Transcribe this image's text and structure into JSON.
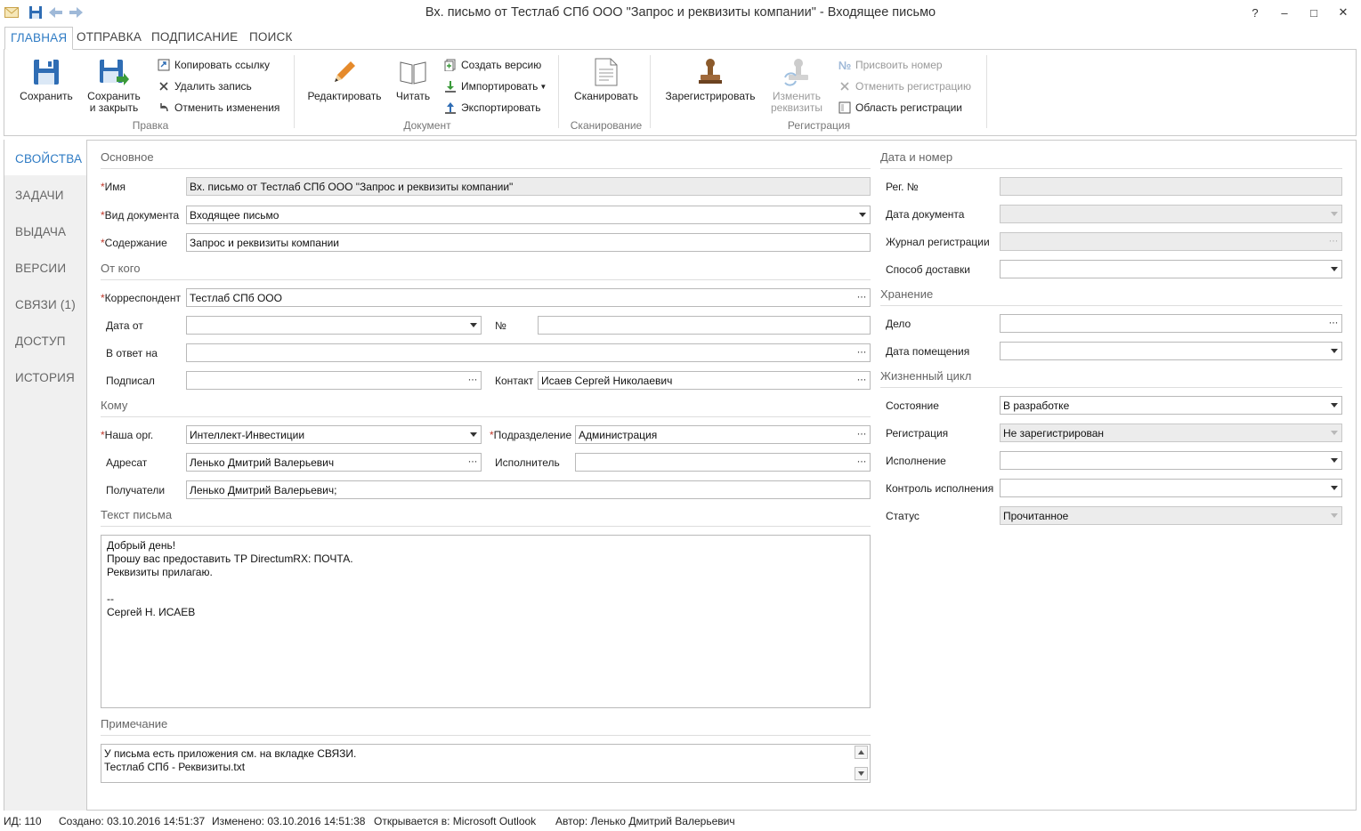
{
  "window": {
    "title": "Вх. письмо от Тестлаб СПб ООО \"Запрос и реквизиты компании\" - Входящее письмо",
    "help": "?",
    "minimize": "–",
    "maximize": "□",
    "close": "✕"
  },
  "ribbon_tabs": [
    "ГЛАВНАЯ",
    "ОТПРАВКА",
    "ПОДПИСАНИЕ",
    "ПОИСК"
  ],
  "ribbon": {
    "save": "Сохранить",
    "save_close_1": "Сохранить",
    "save_close_2": "и закрыть",
    "copy_link": "Копировать ссылку",
    "delete_record": "Удалить запись",
    "undo_changes": "Отменить изменения",
    "group_edit": "Правка",
    "edit": "Редактировать",
    "read": "Читать",
    "create_version": "Создать версию",
    "import": "Импортировать",
    "export": "Экспортировать",
    "group_document": "Документ",
    "scan": "Сканировать",
    "group_scan": "Сканирование",
    "register": "Зарегистрировать",
    "change_requisites_1": "Изменить",
    "change_requisites_2": "реквизиты",
    "assign_number": "Присвоить номер",
    "cancel_registration": "Отменить регистрацию",
    "registration_area": "Область регистрации",
    "group_registration": "Регистрация"
  },
  "leftnav": [
    "СВОЙСТВА",
    "ЗАДАЧИ",
    "ВЫДАЧА",
    "ВЕРСИИ",
    "СВЯЗИ (1)",
    "ДОСТУП",
    "ИСТОРИЯ"
  ],
  "left": {
    "sec_main": "Основное",
    "name_label": "Имя",
    "name_value": "Вх. письмо от Тестлаб СПб ООО \"Запрос и реквизиты компании\"",
    "doctype_label": "Вид документа",
    "doctype_value": "Входящее письмо",
    "content_label": "Содержание",
    "content_value": "Запрос и реквизиты компании",
    "sec_from": "От кого",
    "correspondent_label": "Корреспондент",
    "correspondent_value": "Тестлаб СПб ООО",
    "date_from_label": "Дата от",
    "date_from_value": "",
    "num_label": "№",
    "num_value": "",
    "reply_to_label": "В ответ на",
    "reply_to_value": "",
    "signed_label": "Подписал",
    "signed_value": "",
    "contact_label": "Контакт",
    "contact_value": "Исаев Сергей Николаевич",
    "sec_to": "Кому",
    "our_org_label": "Наша орг.",
    "our_org_value": "Интеллект-Инвестиции",
    "dept_label": "Подразделение",
    "dept_value": "Администрация",
    "addressee_label": "Адресат",
    "addressee_value": "Ленько Дмитрий Валерьевич",
    "executor_label": "Исполнитель",
    "executor_value": "",
    "recipients_label": "Получатели",
    "recipients_value": "Ленько Дмитрий Валерьевич;",
    "sec_text": "Текст письма",
    "letter_text": "Добрый день!\nПрошу вас предоставить ТР DirectumRX: ПОЧТА.\nРеквизиты прилагаю.\n\n--\nСергей Н. ИСАЕВ",
    "sec_note": "Примечание",
    "note_text": "У письма есть приложения см. на вкладке СВЯЗИ.\nТестлаб СПб - Реквизиты.txt"
  },
  "right": {
    "sec_date": "Дата и номер",
    "reg_num_label": "Рег. №",
    "reg_num_value": "",
    "doc_date_label": "Дата документа",
    "doc_date_value": "",
    "journal_label": "Журнал регистрации",
    "journal_value": "",
    "delivery_label": "Способ доставки",
    "delivery_value": "",
    "sec_storage": "Хранение",
    "case_label": "Дело",
    "case_value": "",
    "placement_date_label": "Дата помещения",
    "placement_date_value": "",
    "sec_lifecycle": "Жизненный цикл",
    "state_label": "Состояние",
    "state_value": "В разработке",
    "registration_label": "Регистрация",
    "registration_value": "Не зарегистрирован",
    "execution_label": "Исполнение",
    "execution_value": "",
    "control_label": "Контроль исполнения",
    "control_value": "",
    "status_label": "Статус",
    "status_value": "Прочитанное"
  },
  "statusbar": {
    "id": "ИД: 110",
    "created": "Создано: 03.10.2016 14:51:37",
    "modified": "Изменено: 03.10.2016 14:51:38",
    "opens_in": "Открывается в: Microsoft Outlook",
    "author": "Автор: Ленько Дмитрий Валерьевич"
  },
  "colors": {
    "accent": "#2e7bc4",
    "required": "#c0392b",
    "readonly_bg": "#ececec"
  }
}
